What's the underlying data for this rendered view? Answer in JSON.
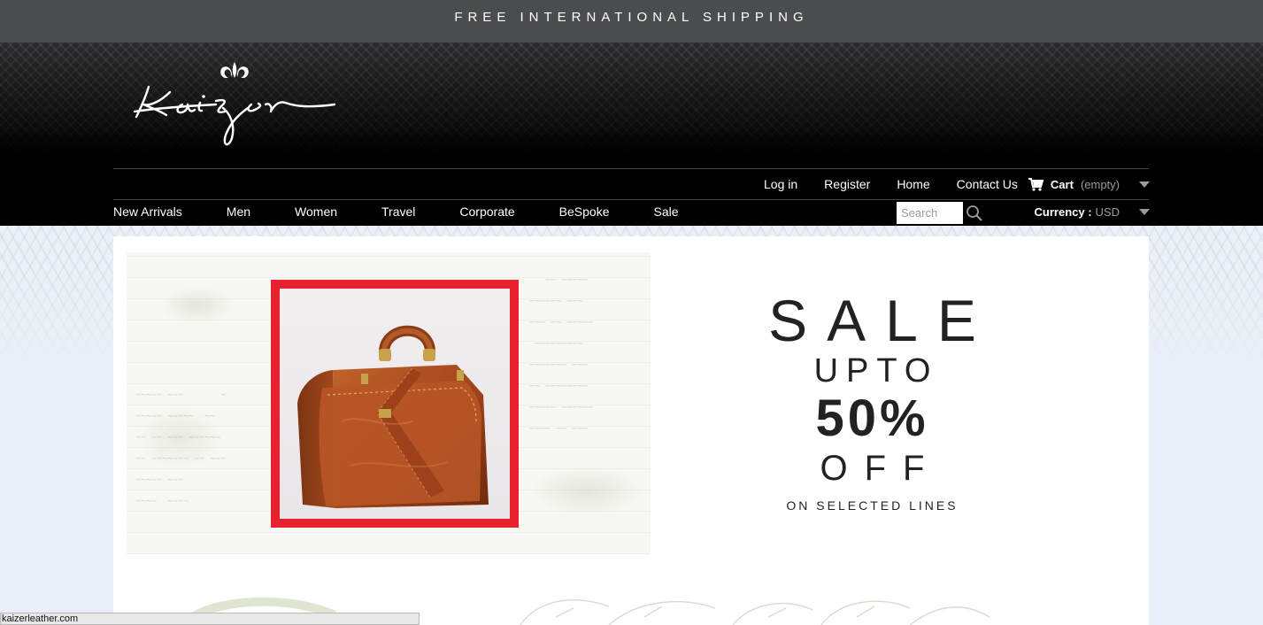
{
  "topbar": {
    "text": "FREE INTERNATIONAL SHIPPING"
  },
  "brand": {
    "logo_text": "Kaizer"
  },
  "top_links": {
    "login": "Log in",
    "register": "Register",
    "home": "Home",
    "contact": "Contact Us",
    "cart_label": "Cart",
    "cart_status": "(empty)"
  },
  "main_nav": {
    "items": [
      {
        "label": "New Arrivals"
      },
      {
        "label": "Men"
      },
      {
        "label": "Women"
      },
      {
        "label": "Travel"
      },
      {
        "label": "Corporate"
      },
      {
        "label": "BeSpoke"
      },
      {
        "label": "Sale"
      }
    ]
  },
  "search": {
    "placeholder": "Search"
  },
  "currency": {
    "label": "Currency :",
    "value": "USD"
  },
  "banner": {
    "title": "SALE",
    "upto": "UPTO",
    "percent": "50%",
    "off": "OFF",
    "subtitle": "ON SELECTED LINES"
  },
  "status_bar": {
    "url": "kaizerleather.com"
  },
  "colors": {
    "topbar_bg": "#4b4c50",
    "header_bg": "#000000",
    "frame_red": "#e8212e",
    "leather": "#a4461c"
  }
}
